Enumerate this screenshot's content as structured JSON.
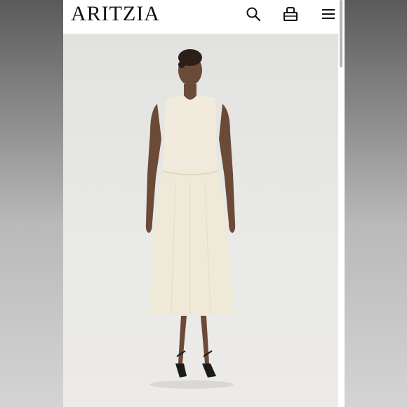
{
  "brand": {
    "name": "ARITZIA"
  },
  "header": {
    "icons": [
      "search-icon",
      "shopping-bag-icon",
      "menu-icon"
    ]
  },
  "product": {
    "image_subject": "model-in-cream-sleeveless-midi-dress",
    "dress_color": "#efe9d8",
    "background_color": "#e6e6e4"
  }
}
